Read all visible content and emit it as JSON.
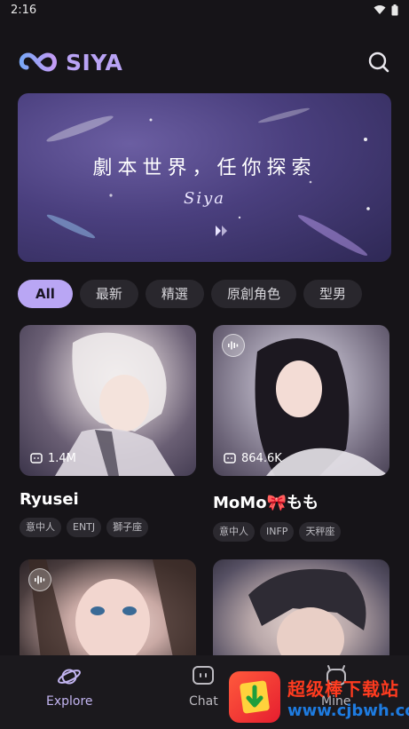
{
  "status_bar": {
    "time": "2:16"
  },
  "header": {
    "app_name": "SIYA"
  },
  "banner": {
    "title": "劇本世界，任你探索",
    "subtitle": "Siya"
  },
  "tabs": [
    {
      "label": "All",
      "active": true
    },
    {
      "label": "最新"
    },
    {
      "label": "精選"
    },
    {
      "label": "原創角色"
    },
    {
      "label": "型男"
    }
  ],
  "cards": [
    {
      "name": "Ryusei",
      "count": "1.4M",
      "voice": false,
      "tags": [
        "意中人",
        "ENTJ",
        "獅子座"
      ]
    },
    {
      "name": "MoMo🎀もも",
      "count": "864.6K",
      "voice": true,
      "tags": [
        "意中人",
        "INFP",
        "天秤座"
      ]
    },
    {
      "voice": true
    },
    {
      "voice": false
    }
  ],
  "bottom_nav": {
    "items": [
      {
        "label": "Explore",
        "active": true
      },
      {
        "label": "Chat"
      },
      {
        "label": "Mine"
      }
    ]
  },
  "watermark": {
    "line1": "超级棒下载站",
    "line2": "www.cjbwh.com"
  },
  "colors": {
    "accent": "#b9a6f4",
    "background": "#161418",
    "chip": "#29272d"
  }
}
